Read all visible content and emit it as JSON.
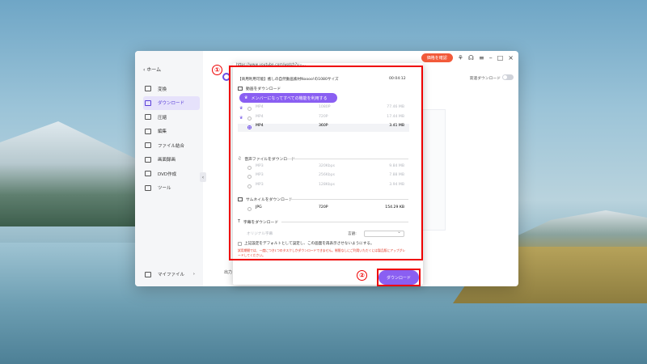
{
  "sidebar": {
    "home": "‹  ホーム",
    "items": [
      {
        "label": "変換",
        "icon": "convert-icon"
      },
      {
        "label": "ダウンロード",
        "icon": "download-icon"
      },
      {
        "label": "圧縮",
        "icon": "compress-icon"
      },
      {
        "label": "編集",
        "icon": "scissors-icon"
      },
      {
        "label": "ファイル結合",
        "icon": "merge-icon"
      },
      {
        "label": "画面録画",
        "icon": "record-icon"
      },
      {
        "label": "DVD作成",
        "icon": "dvd-icon"
      },
      {
        "label": "ツール",
        "icon": "tools-icon"
      }
    ],
    "myfiles": "マイファイル"
  },
  "topbar": {
    "buy": "価格を確認"
  },
  "main": {
    "hq_label": "高速ダウンロード",
    "bottom_text": "出力"
  },
  "dialog": {
    "url": "https://www.youtube.com/watch?v=...",
    "video_title": "【商用利用可能】癒しの自然動画素材Noooo!の1080サイズ",
    "duration": "00:04:12",
    "video_section": "動画をダウンロード",
    "promo": "メンバーになってすべての機能を利用する",
    "video_rows": [
      {
        "format": "MP4",
        "quality": "1080P",
        "size": "77.46 MB"
      },
      {
        "format": "MP4",
        "quality": "720P",
        "size": "17.44 MB"
      },
      {
        "format": "MP4",
        "quality": "360P",
        "size": "3.41 MB"
      }
    ],
    "audio_section": "音声ファイルをダウンロード",
    "audio_rows": [
      {
        "format": "MP3",
        "quality": "320Kbps",
        "size": "9.84 MB"
      },
      {
        "format": "MP3",
        "quality": "256Kbps",
        "size": "7.88 MB"
      },
      {
        "format": "MP3",
        "quality": "128Kbps",
        "size": "3.94 MB"
      }
    ],
    "thumb_section": "サムネイルをダウンロード",
    "thumb_row": {
      "format": "JPG",
      "quality": "720P",
      "size": "154.29 KB"
    },
    "subtitle_section": "字幕をダウンロード",
    "subtitle_original": "オリジナル字幕",
    "language_label": "言語:",
    "default_check": "上記設定をデフォルトとして設定し、この画面を再表示させないようにする。",
    "notice": "試用期間では、一度につき1つのタスクしかダウンロードできません。制限なしにご利用いただくには製品版にアップグレードしてください。",
    "download_button": "ダウンロード"
  },
  "annotations": {
    "badge1": "①",
    "badge2": "②"
  }
}
